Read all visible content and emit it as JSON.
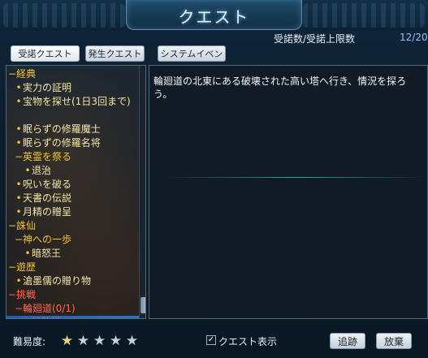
{
  "window": {
    "title": "クエスト"
  },
  "header": {
    "counter_label": "受諾数/受諾上限数",
    "counter_value": "12/20"
  },
  "tabs": [
    {
      "label": "受諾クエスト"
    },
    {
      "label": "発生クエスト"
    },
    {
      "label": "システムイベント"
    }
  ],
  "quest_list": [
    {
      "mark": "−",
      "text": "経典",
      "type": "category"
    },
    {
      "mark": "•",
      "text": "実力の証明",
      "type": "quest"
    },
    {
      "mark": "•",
      "text": "宝物を探せ(1日3回まで)",
      "type": "quest"
    },
    {
      "mark": "•",
      "text": "眠らずの修羅魔士",
      "type": "quest"
    },
    {
      "mark": "•",
      "text": "眠らずの修羅名将",
      "type": "quest"
    },
    {
      "mark": "−",
      "text": "英霊を祭る",
      "type": "group"
    },
    {
      "mark": "•",
      "text": "退治",
      "type": "sub"
    },
    {
      "mark": "•",
      "text": "呪いを破る",
      "type": "quest"
    },
    {
      "mark": "•",
      "text": "天書の伝説",
      "type": "quest"
    },
    {
      "mark": "•",
      "text": "月精の贈呈",
      "type": "quest"
    },
    {
      "mark": "−",
      "text": "誅仙",
      "type": "category"
    },
    {
      "mark": "−",
      "text": "神への一歩",
      "type": "group"
    },
    {
      "mark": "•",
      "text": "暗怒王",
      "type": "sub"
    },
    {
      "mark": "−",
      "text": "遊歴",
      "type": "category"
    },
    {
      "mark": "•",
      "text": "滄墨儒の贈り物",
      "type": "quest"
    },
    {
      "mark": "−",
      "text": "挑戦",
      "type": "category-red"
    },
    {
      "mark": "−",
      "text": "輪廻道(0/1)",
      "type": "group-red"
    },
    {
      "mark": "•",
      "text": "粉砕塔",
      "type": "selected"
    }
  ],
  "description": {
    "text": "輪廻道の北東にある破壊された高い塔へ行き、情況を探ろう。"
  },
  "footer": {
    "difficulty_label": "難易度:",
    "difficulty_stars": 1,
    "difficulty_max": 5,
    "show_quest_label": "クエスト表示",
    "show_quest_checked": true,
    "track_button": "追跡",
    "abandon_button": "放棄"
  }
}
